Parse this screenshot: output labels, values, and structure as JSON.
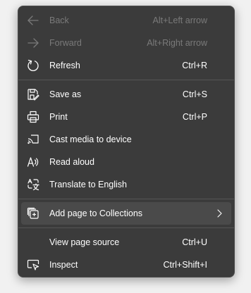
{
  "menu": {
    "groups": [
      [
        {
          "label": "Back",
          "shortcut": "Alt+Left arrow",
          "icon": "arrow-left-icon",
          "disabled": true
        },
        {
          "label": "Forward",
          "shortcut": "Alt+Right arrow",
          "icon": "arrow-right-icon",
          "disabled": true
        },
        {
          "label": "Refresh",
          "shortcut": "Ctrl+R",
          "icon": "refresh-icon",
          "disabled": false
        }
      ],
      [
        {
          "label": "Save as",
          "shortcut": "Ctrl+S",
          "icon": "save-as-icon",
          "disabled": false
        },
        {
          "label": "Print",
          "shortcut": "Ctrl+P",
          "icon": "printer-icon",
          "disabled": false
        },
        {
          "label": "Cast media to device",
          "shortcut": "",
          "icon": "cast-icon",
          "disabled": false
        },
        {
          "label": "Read aloud",
          "shortcut": "",
          "icon": "read-aloud-icon",
          "disabled": false
        },
        {
          "label": "Translate to English",
          "shortcut": "",
          "icon": "translate-icon",
          "disabled": false
        }
      ],
      [
        {
          "label": "Add page to Collections",
          "shortcut": "",
          "icon": "collections-icon",
          "submenu": true,
          "highlighted": true
        }
      ],
      [
        {
          "label": "View page source",
          "shortcut": "Ctrl+U",
          "icon": "",
          "disabled": false
        },
        {
          "label": "Inspect",
          "shortcut": "Ctrl+Shift+I",
          "icon": "inspect-icon",
          "disabled": false
        }
      ]
    ]
  },
  "colors": {
    "menu_background": "#3b3b3b",
    "text": "#ffffff",
    "disabled_text": "#7a7a7a",
    "highlight": "#4a4a4a",
    "separator": "#555555"
  }
}
